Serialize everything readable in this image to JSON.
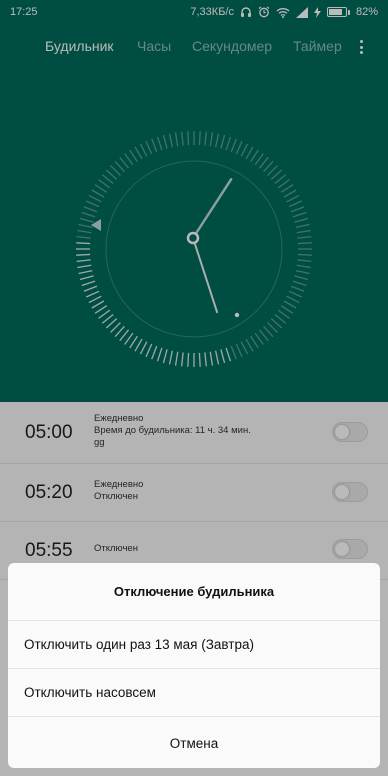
{
  "status_bar": {
    "time": "17:25",
    "network_speed": "7,33КБ/с",
    "battery_percent": "82%",
    "battery_level": 0.82,
    "icons": [
      "headphones-icon",
      "alarm-icon",
      "wifi-icon",
      "signal-icon",
      "charging-icon",
      "battery-icon"
    ]
  },
  "tabs": [
    {
      "label": "Будильник",
      "active": true
    },
    {
      "label": "Часы",
      "active": false
    },
    {
      "label": "Секундомер",
      "active": false
    },
    {
      "label": "Таймер",
      "active": false
    }
  ],
  "colors": {
    "header_bg": "#016a5b",
    "dim_overlay": "rgba(0,0,0,0.27)"
  },
  "clock": {
    "hour_hand_minutes": 5.5,
    "minute_hand_minutes": 27
  },
  "alarms": [
    {
      "time": "05:00",
      "line1": "Ежедневно",
      "line2": "Время до будильника: 11 ч. 34 мин.",
      "line3": "gg",
      "enabled": false
    },
    {
      "time": "05:20",
      "line1": "Ежедневно",
      "line2": "Отключен",
      "enabled": false
    },
    {
      "time": "05:55",
      "line1": "Отключен",
      "enabled": false
    }
  ],
  "dialog": {
    "title": "Отключение будильника",
    "option_once": "Отключить один раз 13 мая (Завтра)",
    "option_forever": "Отключить насовсем",
    "cancel": "Отмена"
  }
}
